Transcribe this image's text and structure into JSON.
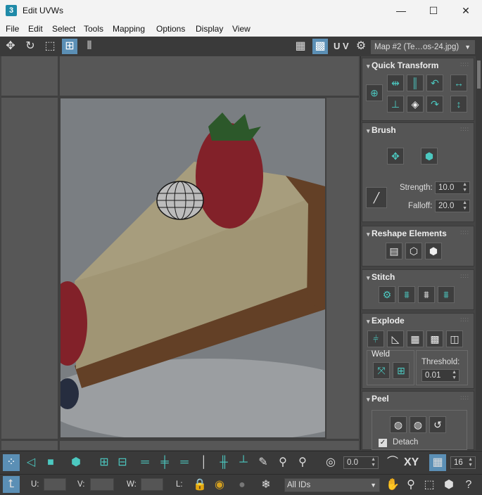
{
  "window": {
    "app_badge": "3",
    "title": "Edit UVWs",
    "minimize": "—",
    "maximize": "☐",
    "close": "✕"
  },
  "menu": [
    "File",
    "Edit",
    "Select",
    "Tools",
    "Mapping",
    "Options",
    "Display",
    "View"
  ],
  "toolbar": {
    "uv_label": "U V",
    "map_selector": "Map #2 (Te…os-24.jpg)"
  },
  "quick_transform": {
    "title": "Quick Transform"
  },
  "brush": {
    "title": "Brush",
    "strength_label": "Strength:",
    "strength_value": "10.0",
    "falloff_label": "Falloff:",
    "falloff_value": "20.0"
  },
  "reshape": {
    "title": "Reshape Elements"
  },
  "stitch": {
    "title": "Stitch"
  },
  "explode": {
    "title": "Explode",
    "weld_label": "Weld",
    "threshold_label": "Threshold:",
    "threshold_value": "0.01"
  },
  "peel": {
    "title": "Peel",
    "detach_label": "Detach",
    "detach_checked": true
  },
  "bottom_bar": {
    "angle_value": "0.0",
    "xy_label": "XY",
    "grid_value": "16"
  },
  "status_bar": {
    "u_label": "U:",
    "v_label": "V:",
    "w_label": "W:",
    "l_label": "L:",
    "ids_select": "All IDs"
  },
  "colors": {
    "accent_teal": "#4cc8c0",
    "panel_bg": "#555555",
    "selected_button": "#5b8fb5"
  }
}
